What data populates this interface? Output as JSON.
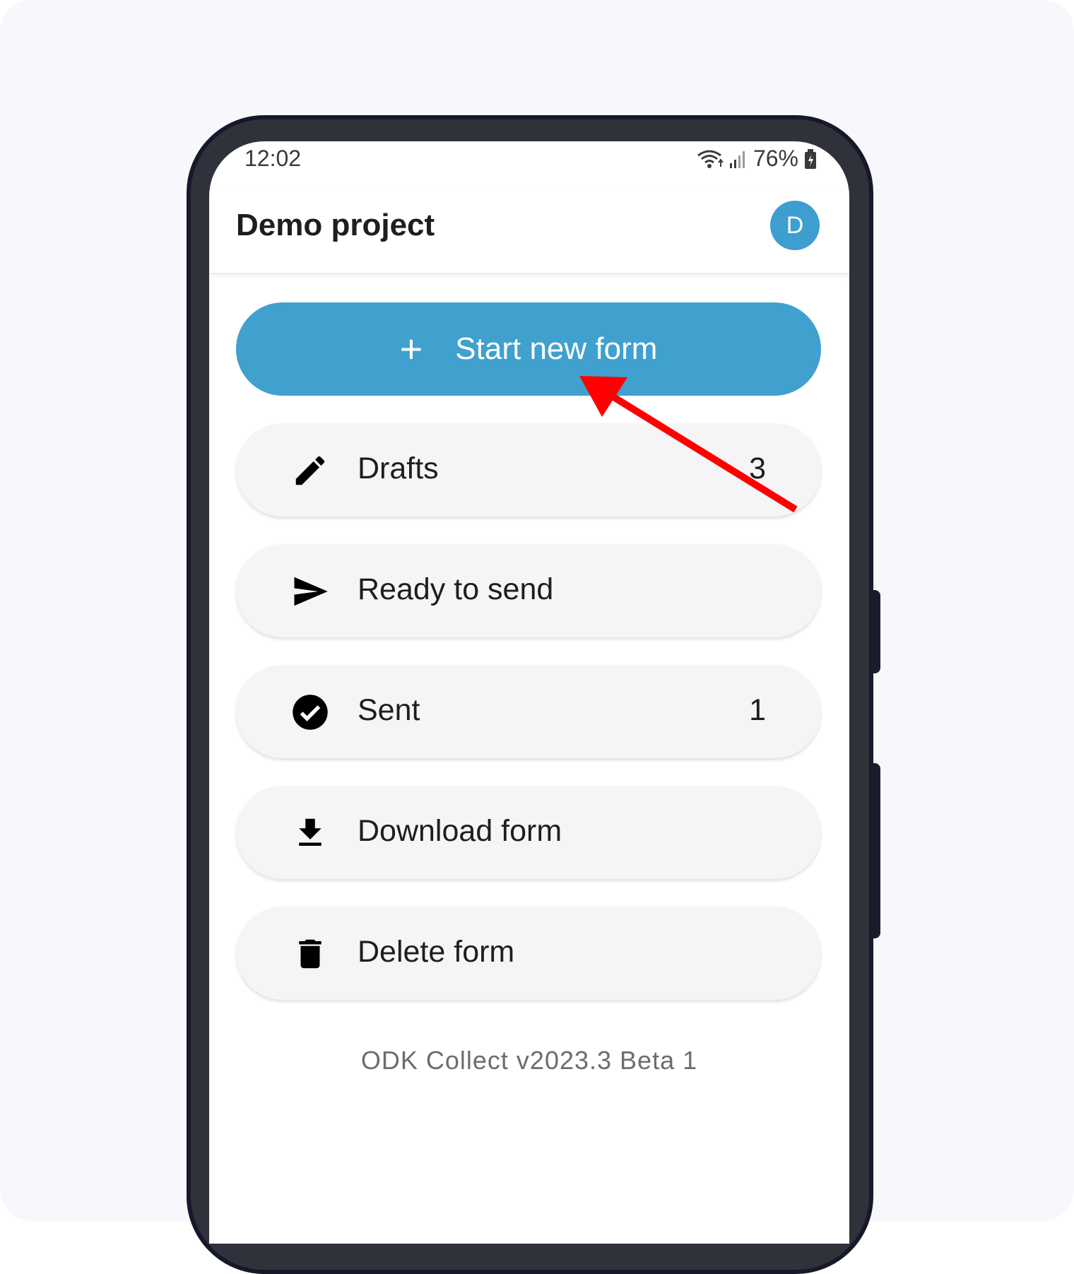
{
  "status_bar": {
    "time": "12:02",
    "battery": "76%"
  },
  "app_bar": {
    "title": "Demo project",
    "avatar_initial": "D"
  },
  "primary_action": {
    "icon": "plus-icon",
    "label": "Start new form"
  },
  "menu": [
    {
      "icon": "pencil-icon",
      "label": "Drafts",
      "count": "3"
    },
    {
      "icon": "send-icon",
      "label": "Ready to send",
      "count": ""
    },
    {
      "icon": "check-circle-icon",
      "label": "Sent",
      "count": "1"
    },
    {
      "icon": "download-icon",
      "label": "Download form",
      "count": ""
    },
    {
      "icon": "trash-icon",
      "label": "Delete form",
      "count": ""
    }
  ],
  "footer": {
    "version": "ODK Collect v2023.3 Beta 1"
  },
  "colors": {
    "accent": "#40a0ce",
    "annotation_arrow": "#ff0000"
  }
}
